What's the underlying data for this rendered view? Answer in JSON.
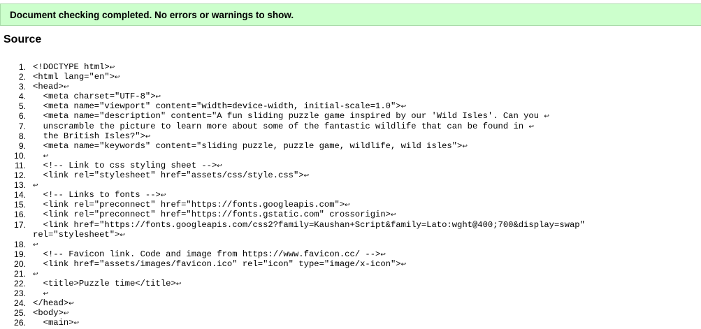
{
  "banner": {
    "message": "Document checking completed. No errors or warnings to show."
  },
  "source": {
    "title": "Source",
    "newline_glyph": "↩",
    "lines": [
      {
        "n": "1.",
        "rows": [
          "<!DOCTYPE html>↩"
        ]
      },
      {
        "n": "2.",
        "rows": [
          "<html lang=\"en\">↩"
        ]
      },
      {
        "n": "3.",
        "rows": [
          "<head>↩"
        ]
      },
      {
        "n": "4.",
        "rows": [
          "  <meta charset=\"UTF-8\">↩"
        ]
      },
      {
        "n": "5.",
        "rows": [
          "  <meta name=\"viewport\" content=\"width=device-width, initial-scale=1.0\">↩"
        ]
      },
      {
        "n": "6.",
        "rows": [
          "  <meta name=\"description\" content=\"A fun sliding puzzle game inspired by our 'Wild Isles'. Can you ↩"
        ]
      },
      {
        "n": "7.",
        "rows": [
          "  unscramble the picture to learn more about some of the fantastic wildlife that can be found in ↩"
        ]
      },
      {
        "n": "8.",
        "rows": [
          "  the British Isles?\">↩"
        ]
      },
      {
        "n": "9.",
        "rows": [
          "  <meta name=\"keywords\" content=\"sliding puzzle, puzzle game, wildlife, wild isles\">↩"
        ]
      },
      {
        "n": "10.",
        "rows": [
          "  ↩"
        ]
      },
      {
        "n": "11.",
        "rows": [
          "  <!-- Link to css styling sheet -->↩"
        ]
      },
      {
        "n": "12.",
        "rows": [
          "  <link rel=\"stylesheet\" href=\"assets/css/style.css\">↩"
        ]
      },
      {
        "n": "13.",
        "rows": [
          "↩"
        ]
      },
      {
        "n": "14.",
        "rows": [
          "  <!-- Links to fonts -->↩"
        ]
      },
      {
        "n": "15.",
        "rows": [
          "  <link rel=\"preconnect\" href=\"https://fonts.googleapis.com\">↩"
        ]
      },
      {
        "n": "16.",
        "rows": [
          "  <link rel=\"preconnect\" href=\"https://fonts.gstatic.com\" crossorigin>↩"
        ]
      },
      {
        "n": "17.",
        "rows": [
          "  <link href=\"https://fonts.googleapis.com/css2?family=Kaushan+Script&family=Lato:wght@400;700&display=swap\"",
          "rel=\"stylesheet\">↩"
        ]
      },
      {
        "n": "18.",
        "rows": [
          "↩"
        ]
      },
      {
        "n": "19.",
        "rows": [
          "  <!-- Favicon link. Code and image from https://www.favicon.cc/ -->↩"
        ]
      },
      {
        "n": "20.",
        "rows": [
          "  <link href=\"assets/images/favicon.ico\" rel=\"icon\" type=\"image/x-icon\">↩"
        ]
      },
      {
        "n": "21.",
        "rows": [
          "↩"
        ]
      },
      {
        "n": "22.",
        "rows": [
          "  <title>Puzzle time</title>↩"
        ]
      },
      {
        "n": "23.",
        "rows": [
          "  ↩"
        ]
      },
      {
        "n": "24.",
        "rows": [
          "</head>↩"
        ]
      },
      {
        "n": "25.",
        "rows": [
          "<body>↩"
        ]
      },
      {
        "n": "26.",
        "rows": [
          "  <main>↩"
        ]
      }
    ]
  }
}
